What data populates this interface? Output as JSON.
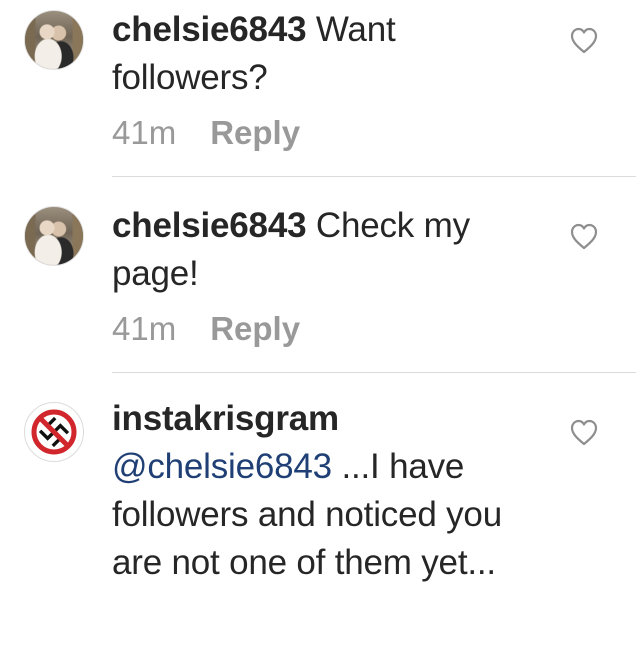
{
  "comments": [
    {
      "username": "chelsie6843",
      "text": "Want followers?",
      "time": "41m",
      "reply_label": "Reply"
    },
    {
      "username": "chelsie6843",
      "text": "Check my page!",
      "time": "41m",
      "reply_label": "Reply"
    },
    {
      "username": "instakrisgram",
      "mention": "@chelsie6843",
      "text": "...I have followers and noticed you are not one of them yet..."
    }
  ],
  "icons": {
    "like": "heart-outline-icon",
    "avatar_logo": "prohibited-symbol-icon"
  },
  "colors": {
    "username": "#262626",
    "mention": "#1f3f75",
    "meta": "#999999",
    "prohibit_red": "#d0262c"
  }
}
